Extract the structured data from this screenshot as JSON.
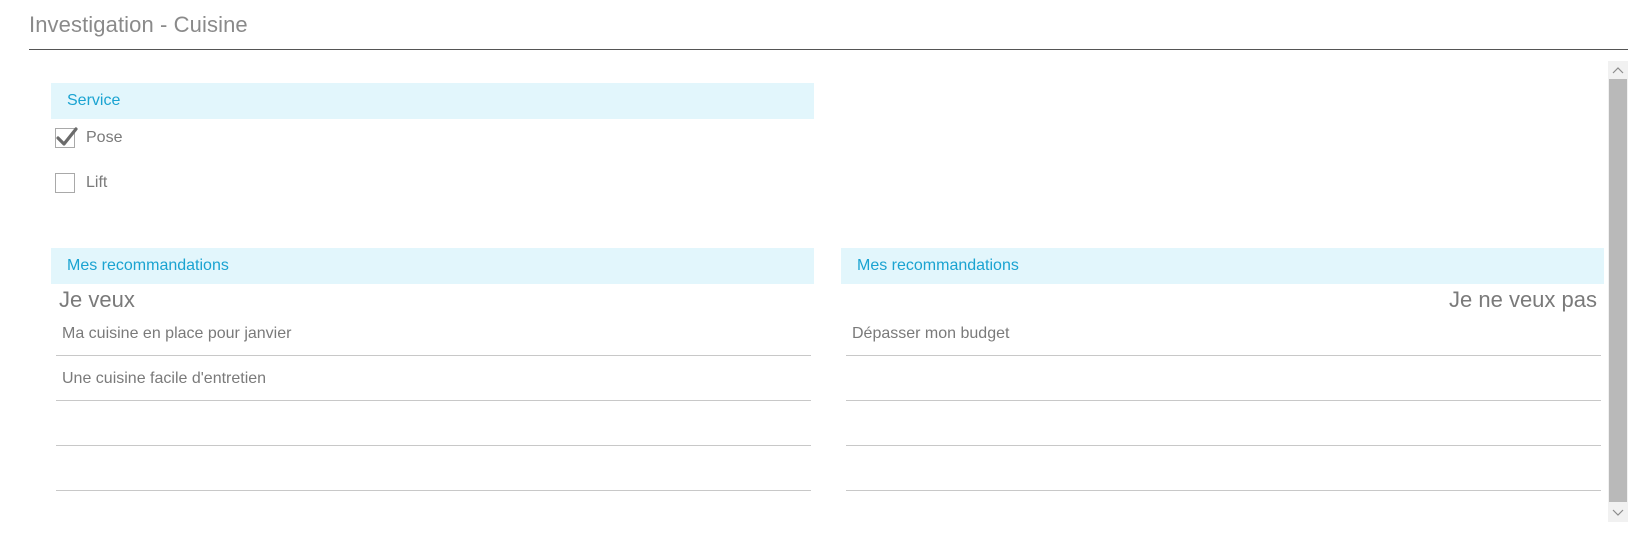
{
  "page": {
    "title": "Investigation - Cuisine"
  },
  "service": {
    "header": "Service",
    "options": [
      {
        "label": "Pose",
        "checked": true
      },
      {
        "label": "Lift",
        "checked": false
      }
    ]
  },
  "left_panel": {
    "header": "Mes recommandations",
    "heading": "Je veux",
    "lines": [
      "Ma cuisine en place pour janvier",
      "Une cuisine facile d'entretien",
      "",
      ""
    ]
  },
  "right_panel": {
    "header": "Mes recommandations",
    "heading": "Je ne veux pas",
    "lines": [
      "Dépasser mon budget",
      "",
      "",
      ""
    ]
  },
  "icons": {
    "checkmark": "check-icon",
    "scroll_up": "chevron-up-icon",
    "scroll_down": "chevron-down-icon"
  },
  "colors": {
    "section_header_bg": "#e2f6fc",
    "section_header_text": "#1aa3d1",
    "body_text": "#7a7a7a"
  }
}
